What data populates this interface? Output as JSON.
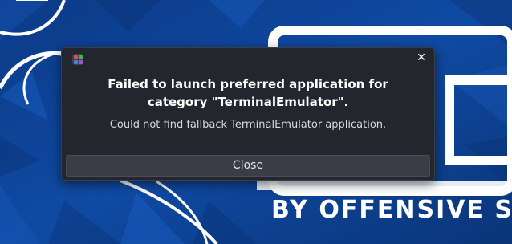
{
  "wallpaper": {
    "brand_text": "BY OFFENSIVE SECU",
    "background_color": "#0b3f8f"
  },
  "dialog": {
    "title_line_1": "Failed to launch preferred application for",
    "title_line_2": "category \"TerminalEmulator\".",
    "message": "Could not find fallback TerminalEmulator application.",
    "close_button_label": "Close",
    "close_icon_glyph": "✕",
    "app_icon": "app-grid-icon",
    "app_icon_colors": [
      "#e34b4b",
      "#4bb04f",
      "#4a7ee0",
      "#9b59d0"
    ]
  }
}
